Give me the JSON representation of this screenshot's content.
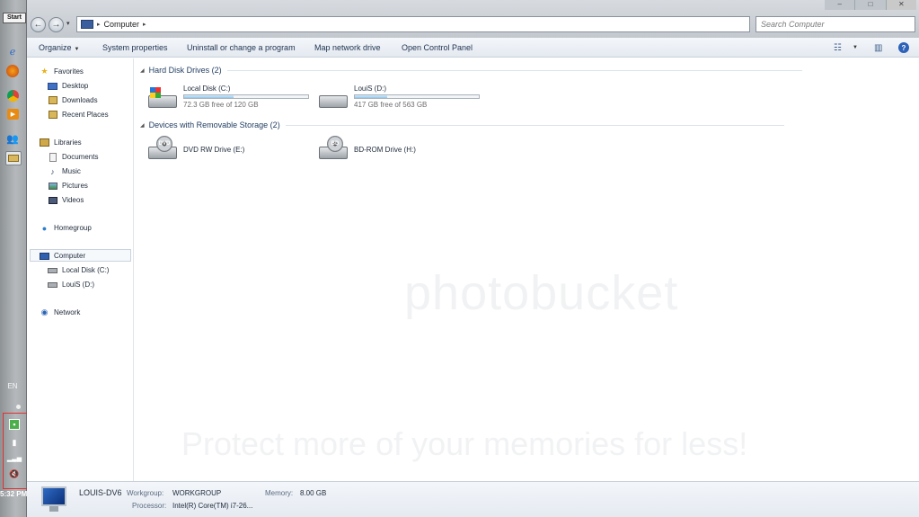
{
  "taskbar": {
    "start_label": "Start",
    "lang": "EN",
    "clock": "5:32 PM",
    "apps": [
      "ie-icon",
      "firefox-icon",
      "chrome-icon",
      "media-player-icon",
      "users-icon",
      "explorer-icon"
    ],
    "tray": [
      "action-center-icon",
      "power-icon",
      "signal-icon",
      "volume-muted-icon"
    ]
  },
  "window": {
    "controls": [
      "–",
      "□",
      "✕"
    ]
  },
  "address": {
    "crumb": "Computer",
    "search_placeholder": "Search Computer"
  },
  "commandbar": {
    "organize": "Organize",
    "system_properties": "System properties",
    "uninstall": "Uninstall or change a program",
    "map_drive": "Map network drive",
    "control_panel": "Open Control Panel"
  },
  "navpane": {
    "favorites": "Favorites",
    "desktop": "Desktop",
    "downloads": "Downloads",
    "recent": "Recent Places",
    "libraries": "Libraries",
    "documents": "Documents",
    "music": "Music",
    "pictures": "Pictures",
    "videos": "Videos",
    "homegroup": "Homegroup",
    "computer": "Computer",
    "local_disk": "Local Disk (C:)",
    "louis": "LouiS (D:)",
    "network": "Network"
  },
  "content": {
    "hdd_header": "Hard Disk Drives (2)",
    "removable_header": "Devices with Removable Storage (2)",
    "drives": [
      {
        "name": "Local Disk (C:)",
        "free": "72.3 GB free of 120 GB",
        "used_fraction": 0.4
      },
      {
        "name": "LouiS (D:)",
        "free": "417 GB free of 563 GB",
        "used_fraction": 0.26
      }
    ],
    "removable": [
      {
        "name": "DVD RW Drive (E:)",
        "badge": "DVD"
      },
      {
        "name": "BD-ROM Drive (H:)",
        "badge": "BD"
      }
    ]
  },
  "details": {
    "pc_name": "LOUIS-DV6",
    "workgroup_label": "Workgroup:",
    "workgroup_value": "WORKGROUP",
    "memory_label": "Memory:",
    "memory_value": "8.00 GB",
    "processor_label": "Processor:",
    "processor_value": "Intel(R) Core(TM) i7-26..."
  },
  "watermark": {
    "line1": "photobucket",
    "line2": "Protect more of your memories for less!"
  }
}
